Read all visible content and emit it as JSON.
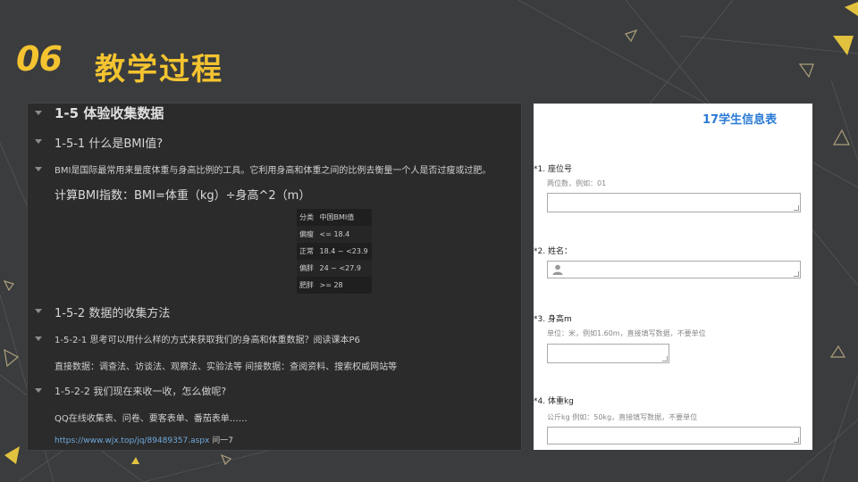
{
  "slide": {
    "number": "06",
    "title": "教学过程"
  },
  "notes": {
    "items": [
      {
        "text": "1-5 体验收集数据"
      },
      {
        "text": "1-5-1 什么是BMI值?"
      },
      {
        "text": "BMI是国际最常用来量度体重与身高比例的工具。它利用身高和体重之间的比例去衡量一个人是否过瘦或过肥。"
      },
      {
        "text": "计算BMI指数：BMI=体重（kg）÷身高^2（m）"
      },
      {
        "text": "1-5-2 数据的收集方法"
      },
      {
        "text": "1-5-2-1 思考可以用什么样的方式来获取我们的身高和体重数据？阅读课本P6"
      },
      {
        "text": "直接数据：调查法、访谈法、观察法、实验法等 间接数据：查阅资料、搜索权威网站等"
      },
      {
        "text": "1-5-2-2 我们现在来收一收，怎么做呢?"
      },
      {
        "text": "QQ在线收集表、问卷、要客表单、番茄表单……"
      }
    ],
    "link": {
      "url": "https://www.wjx.top/jq/89489357.aspx",
      "tail": " 问一7"
    },
    "bmi_table": {
      "headers": [
        "分类",
        "中国BMI值"
      ],
      "rows": [
        [
          "偏瘦",
          "<= 18.4"
        ],
        [
          "正常",
          "18.4 ~ <23.9"
        ],
        [
          "偏胖",
          "24 ~ <27.9"
        ],
        [
          "肥胖",
          ">= 28"
        ]
      ]
    }
  },
  "form": {
    "title": "17学生信息表",
    "questions": [
      {
        "label": "*1. 座位号",
        "hint": "两位数，例如：01"
      },
      {
        "label": "*2. 姓名："
      },
      {
        "label": "*3. 身高m",
        "hint": "单位：米，例如1.60m，直接填写数据，不要单位"
      },
      {
        "label": "*4. 体重kg",
        "hint": "公斤kg 例如：50kg，直接填写数据，不要单位"
      }
    ]
  },
  "icons": [
    "person-icon",
    "caret-down-icon",
    "resize-grip-icon"
  ],
  "colors": {
    "accent": "#f4c430",
    "link": "#6fa8dc",
    "form_title": "#2a7ad6"
  }
}
